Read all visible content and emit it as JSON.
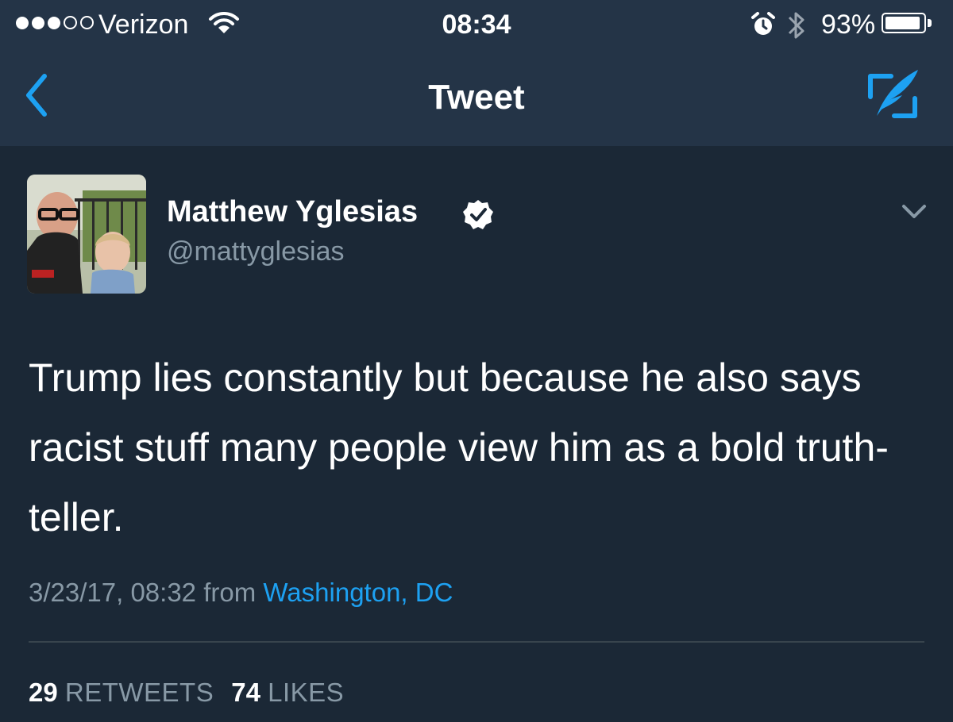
{
  "status_bar": {
    "carrier": "Verizon",
    "time": "08:34",
    "battery_percent": "93%",
    "battery_level": 0.93,
    "signal_bars": 3,
    "signal_total": 5
  },
  "nav": {
    "title": "Tweet",
    "back_icon": "chevron-left-icon",
    "compose_icon": "compose-tweet-icon"
  },
  "tweet": {
    "author_name": "Matthew Yglesias",
    "handle": "@mattyglesias",
    "verified": true,
    "text": "Trump lies constantly but because he also says racist stuff many people view him as a bold truth-teller.",
    "timestamp": "3/23/17, 08:32",
    "from_label": "from",
    "location": "Washington, DC",
    "retweets_count": "29",
    "retweets_label": "RETWEETS",
    "likes_count": "74",
    "likes_label": "LIKES"
  },
  "colors": {
    "background": "#1b2836",
    "header": "#243447",
    "accent": "#1da1f2",
    "secondary_text": "#8899a6"
  }
}
